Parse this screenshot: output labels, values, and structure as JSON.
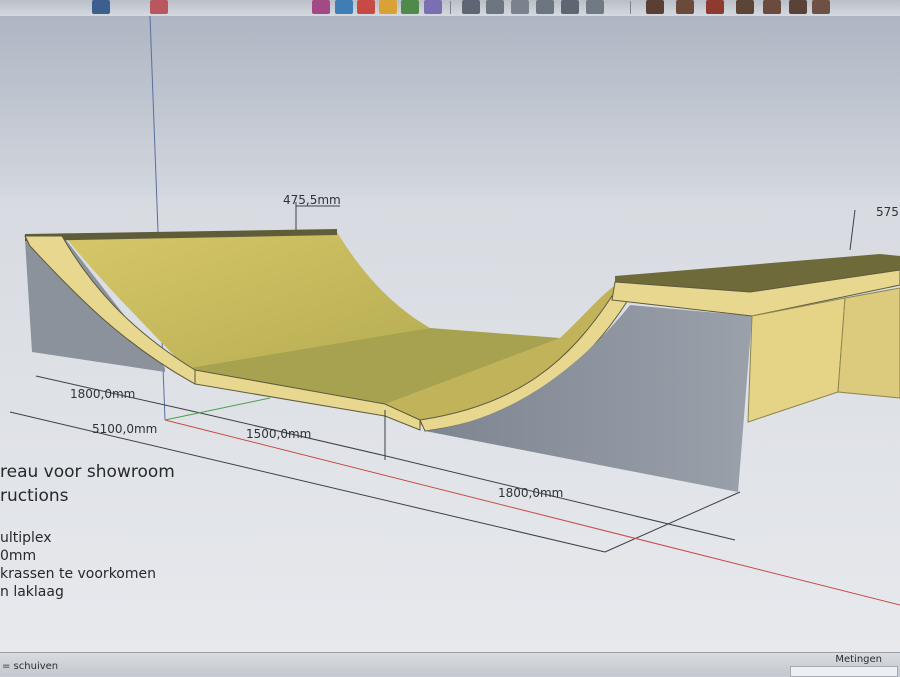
{
  "toolbar": {
    "icons": [
      "select-icon",
      "eraser-icon",
      "paint-icon",
      "move-icon",
      "rotate-icon",
      "scale-icon",
      "pushpull-icon",
      "offset-icon",
      "standard-view-icon",
      "iso-view-icon",
      "top-view-icon",
      "front-view-icon",
      "right-view-icon",
      "shaded-icon",
      "texture-icon",
      "xray-icon",
      "wireframe-icon",
      "style-icon"
    ]
  },
  "model": {
    "colors": {
      "sky": "#c7ccd5",
      "ground": "#dfe2e7",
      "ply_edge": "#e7d58c",
      "curve_face": "#cdbf5f",
      "flat_face": "#aaa351",
      "side_face": "#8a919b",
      "deck_top": "#6f6a3a"
    },
    "dimensions": {
      "coping_radius": "475,5mm",
      "deck_height": "575",
      "transition_left": "1800,0mm",
      "total_length": "5100,0mm",
      "flat_bottom": "1500,0mm",
      "transition_right": "1800,0mm"
    }
  },
  "notes": {
    "title_line1": "reau voor showroom",
    "title_line2": "ructions",
    "lines": [
      "ultiplex",
      "0mm",
      "krassen te voorkomen",
      "n laklaag"
    ]
  },
  "statusbar": {
    "hint": "= schuiven",
    "measurements_label": "Metingen",
    "measurements_value": ""
  }
}
